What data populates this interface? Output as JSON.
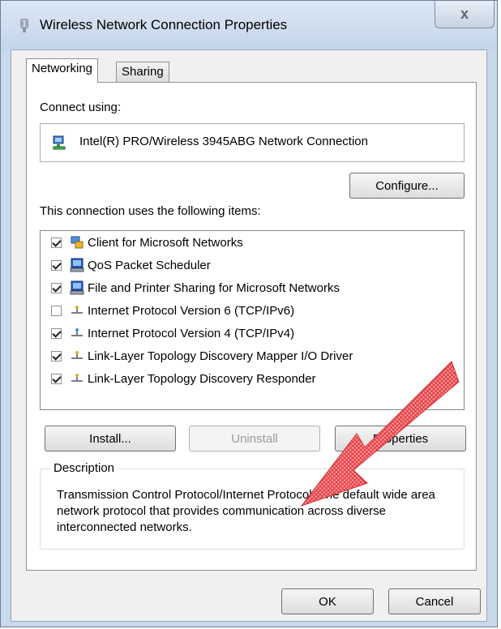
{
  "window": {
    "title": "Wireless Network Connection Properties",
    "close_label": "x"
  },
  "tabs": [
    {
      "label": "Networking",
      "active": true
    },
    {
      "label": "Sharing",
      "active": false
    }
  ],
  "connect_using": {
    "label": "Connect using:",
    "adapter": "Intel(R) PRO/Wireless 3945ABG Network Connection",
    "configure_label": "Configure..."
  },
  "items_section": {
    "label": "This connection uses the following items:",
    "items": [
      {
        "label": "Client for Microsoft Networks",
        "checked": true,
        "icon": "network-client-icon"
      },
      {
        "label": "QoS Packet Scheduler",
        "checked": true,
        "icon": "computer-service-icon"
      },
      {
        "label": "File and Printer Sharing for Microsoft Networks",
        "checked": true,
        "icon": "computer-service-icon"
      },
      {
        "label": "Internet Protocol Version 6 (TCP/IPv6)",
        "checked": false,
        "icon": "protocol-icon"
      },
      {
        "label": "Internet Protocol Version 4 (TCP/IPv4)",
        "checked": true,
        "icon": "protocol-icon"
      },
      {
        "label": "Link-Layer Topology Discovery Mapper I/O Driver",
        "checked": true,
        "icon": "protocol-icon"
      },
      {
        "label": "Link-Layer Topology Discovery Responder",
        "checked": true,
        "icon": "protocol-icon"
      }
    ]
  },
  "buttons": {
    "install": "Install...",
    "uninstall": "Uninstall",
    "properties": "Properties",
    "ok": "OK",
    "cancel": "Cancel"
  },
  "description": {
    "legend": "Description",
    "text": "Transmission Control Protocol/Internet Protocol. The default wide area network protocol that provides communication across diverse interconnected networks."
  },
  "colors": {
    "arrow": "#e8383d",
    "title_bar": "#c9d8ea"
  }
}
